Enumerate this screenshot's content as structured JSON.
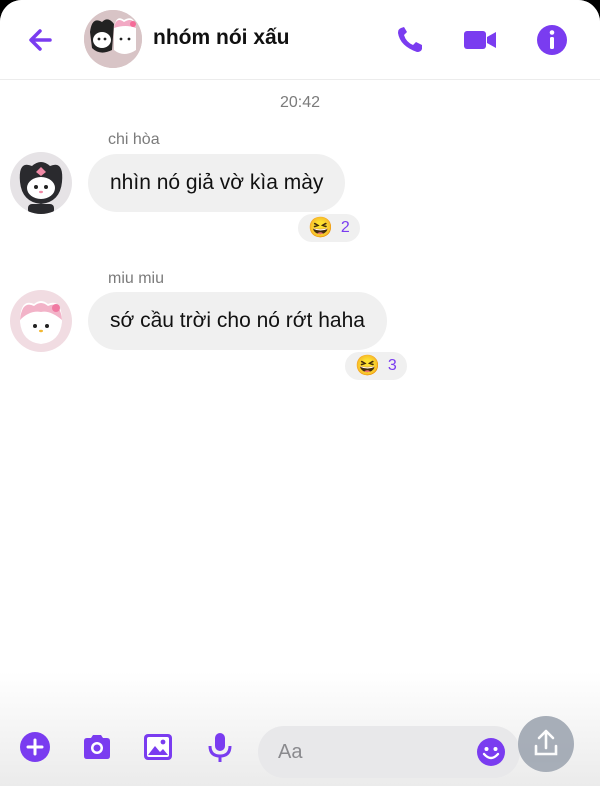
{
  "colors": {
    "accent": "#7a3cf0",
    "bubble": "#f0f0f0",
    "muted": "#7b7b7b"
  },
  "header": {
    "title": "nhóm nói xấu",
    "icons": [
      "back-arrow-icon",
      "phone-icon",
      "video-camera-icon",
      "info-icon"
    ]
  },
  "chat": {
    "timestamp": "20:42",
    "messages": [
      {
        "sender": "chi hòa",
        "text": "nhìn nó giả vờ kìa mày",
        "reaction_emoji": "😆",
        "reaction_count": "2"
      },
      {
        "sender": "miu miu",
        "text": "sớ cầu trời cho nó rớt haha",
        "reaction_emoji": "😆",
        "reaction_count": "3"
      }
    ]
  },
  "composer": {
    "placeholder": "Aa",
    "icons": [
      "plus-icon",
      "camera-icon",
      "image-icon",
      "microphone-icon",
      "emoji-icon",
      "share-icon"
    ]
  }
}
